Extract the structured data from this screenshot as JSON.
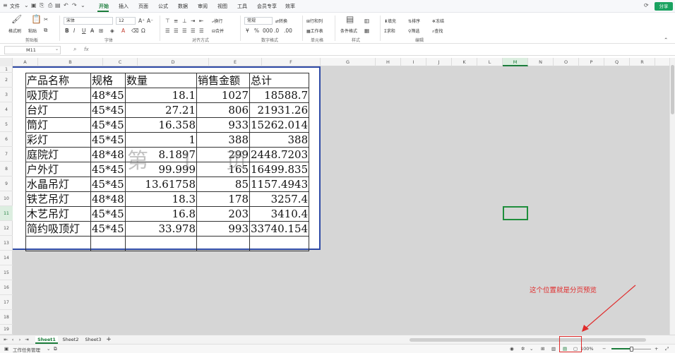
{
  "menubar": {
    "file": "文件",
    "tabs": [
      "开始",
      "插入",
      "页面",
      "公式",
      "数据",
      "审阅",
      "视图",
      "工具",
      "会员专享",
      "效率"
    ],
    "active_tab": "开始",
    "share": "分享"
  },
  "ribbon": {
    "format_painter": "格式刷",
    "paste": "粘贴",
    "font_name": "宋体",
    "font_size": "12",
    "wrap": "换行",
    "merge": "合并",
    "number_format": "常规",
    "convert": "转换",
    "rows_cols": "行和列",
    "worksheet": "工作表",
    "cond_format": "条件格式",
    "fill": "填充",
    "sort": "排序",
    "freeze": "冻结",
    "sum": "求和",
    "filter": "筛选",
    "find": "查找",
    "groups": {
      "clipboard": "剪贴板",
      "font": "字体",
      "align": "对齐方式",
      "number": "数字格式",
      "cells": "单元格",
      "style": "样式",
      "edit": "编辑"
    }
  },
  "formula_bar": {
    "cell_ref": "M11",
    "fx": "fx",
    "value": ""
  },
  "columns": [
    "A",
    "B",
    "C",
    "D",
    "E",
    "F",
    "G",
    "H",
    "I",
    "J",
    "K",
    "L",
    "M",
    "N",
    "O",
    "P",
    "Q",
    "R"
  ],
  "selected_column": "M",
  "rows": [
    "1",
    "2",
    "3",
    "4",
    "5",
    "6",
    "7",
    "8",
    "9",
    "10",
    "11",
    "12",
    "13",
    "14",
    "15",
    "16",
    "17",
    "18",
    "19"
  ],
  "selected_row": "11",
  "table": {
    "header": [
      "产品名称",
      "规格",
      "数量",
      "销售金额",
      "总计"
    ],
    "rows": [
      [
        "吸顶灯",
        "48*45",
        "18.1",
        "1027",
        "18588.7"
      ],
      [
        "台灯",
        "45*45",
        "27.21",
        "806",
        "21931.26"
      ],
      [
        "筒灯",
        "45*45",
        "16.358",
        "933",
        "15262.014"
      ],
      [
        "彩灯",
        "45*45",
        "1",
        "388",
        "388"
      ],
      [
        "庭院灯",
        "48*48",
        "8.1897",
        "299",
        "2448.7203"
      ],
      [
        "户外灯",
        "45*45",
        "99.999",
        "165",
        "16499.835"
      ],
      [
        "水晶吊灯",
        "45*45",
        "13.61758",
        "85",
        "1157.4943"
      ],
      [
        "铁艺吊灯",
        "48*48",
        "18.3",
        "178",
        "3257.4"
      ],
      [
        "木艺吊灯",
        "45*45",
        "16.8",
        "203",
        "3410.4"
      ],
      [
        "简约吸顶灯",
        "45*45",
        "33.978",
        "993",
        "33740.154"
      ]
    ]
  },
  "watermark": "第 1 页",
  "annotation": "这个位置就是分页预览",
  "sheets": [
    "Sheet1",
    "Sheet2",
    "Sheet3"
  ],
  "active_sheet": "Sheet1",
  "add_sheet": "+",
  "statusbar": {
    "task_manager": "工作任务管理",
    "zoom": "100%"
  }
}
